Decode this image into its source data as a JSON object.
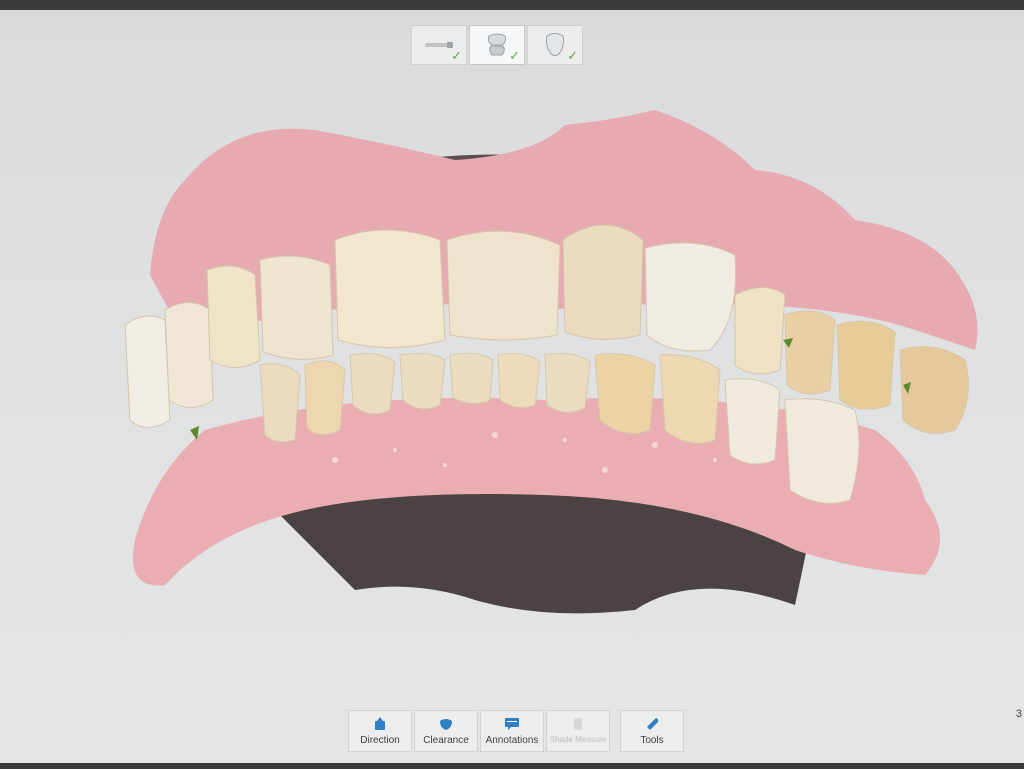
{
  "stages": [
    {
      "icon": "scanner-wand-icon",
      "active": false,
      "completed": true
    },
    {
      "icon": "tooth-bite-icon",
      "active": true,
      "completed": true
    },
    {
      "icon": "tooth-crown-icon",
      "active": false,
      "completed": true
    }
  ],
  "tools": [
    {
      "label": "Direction",
      "icon": "direction-icon",
      "enabled": true
    },
    {
      "label": "Clearance",
      "icon": "clearance-icon",
      "enabled": true
    },
    {
      "label": "Annotations",
      "icon": "annotations-icon",
      "enabled": true
    },
    {
      "label": "Shade Measure",
      "icon": "shade-measure-icon",
      "enabled": false
    },
    {
      "label": "Tools",
      "icon": "wrench-icon",
      "enabled": true
    }
  ],
  "viewport": {
    "model": "3D intraoral scan – full arch bite",
    "gum_color": "#e8a8ad",
    "tooth_color": "#efe4cf"
  },
  "edge_glyph": "3"
}
